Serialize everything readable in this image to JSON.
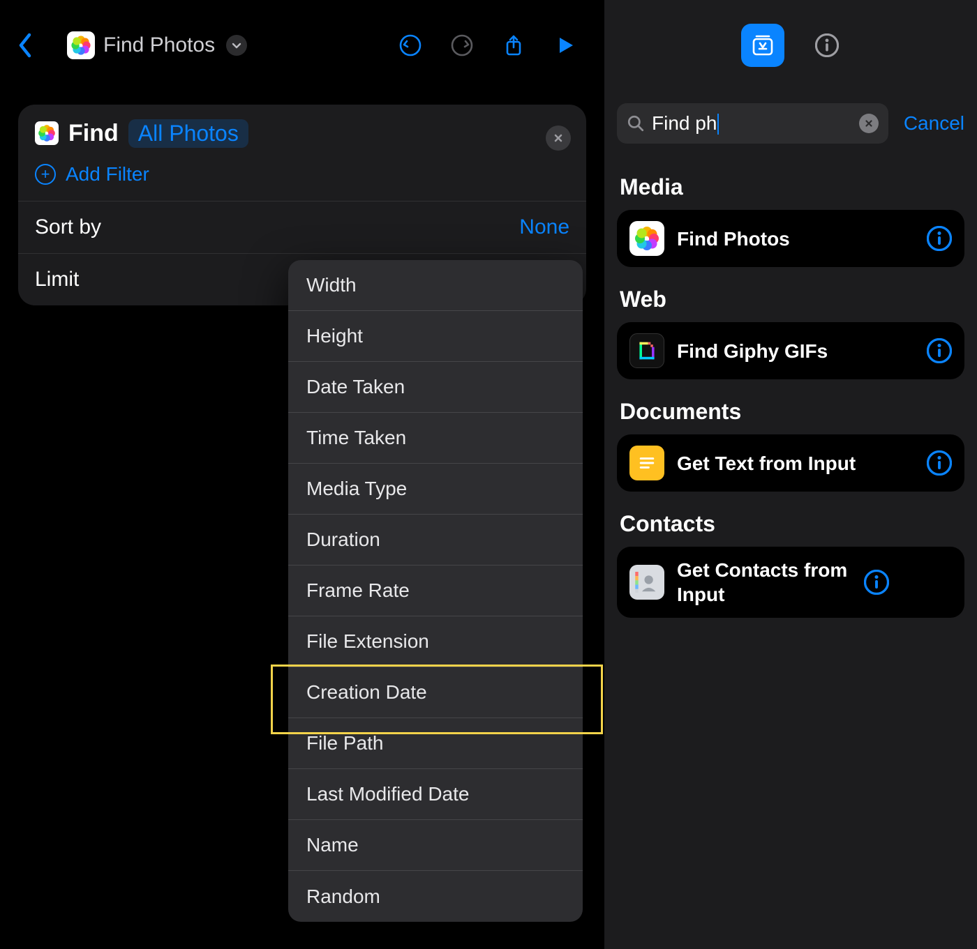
{
  "left": {
    "header_title": "Find Photos",
    "card": {
      "find_label": "Find",
      "tag": "All Photos",
      "add_filter": "Add Filter",
      "sort_by_label": "Sort by",
      "sort_by_value": "None",
      "limit_label": "Limit"
    },
    "menu": [
      "Width",
      "Height",
      "Date Taken",
      "Time Taken",
      "Media Type",
      "Duration",
      "Frame Rate",
      "File Extension",
      "Creation Date",
      "File Path",
      "Last Modified Date",
      "Name",
      "Random"
    ],
    "highlighted_menu_item": "Creation Date"
  },
  "right": {
    "search_text": "Find ph",
    "cancel": "Cancel",
    "sections": {
      "media": {
        "header": "Media",
        "items": [
          {
            "label": "Find Photos"
          }
        ]
      },
      "web": {
        "header": "Web",
        "items": [
          {
            "label": "Find Giphy GIFs"
          }
        ]
      },
      "documents": {
        "header": "Documents",
        "items": [
          {
            "label": "Get Text from Input"
          }
        ]
      },
      "contacts": {
        "header": "Contacts",
        "items": [
          {
            "label": "Get Contacts from Input"
          }
        ]
      }
    }
  }
}
